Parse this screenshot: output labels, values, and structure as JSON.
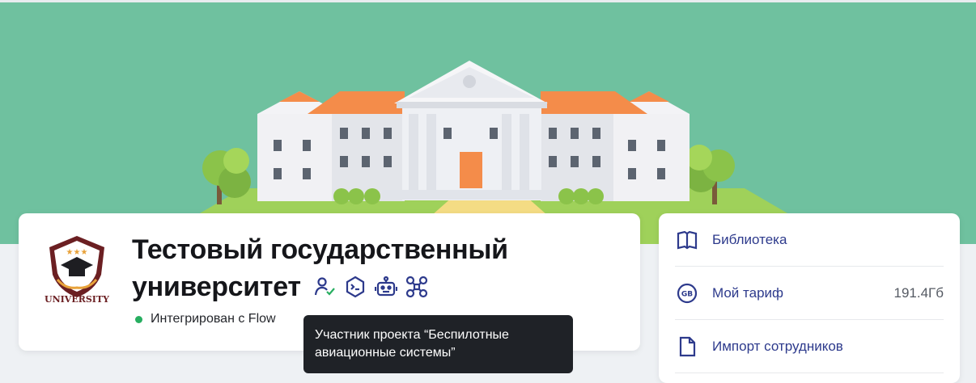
{
  "organization": {
    "title_line1": "Тестовый государственный",
    "title_line2": "университет",
    "logo_text": "UNIVERSITY",
    "status_text": "Интегрирован с Flow",
    "status_color": "#27ae60",
    "badges": [
      {
        "icon": "user-check-icon"
      },
      {
        "icon": "terminal-hexagon-icon"
      },
      {
        "icon": "robot-icon"
      },
      {
        "icon": "drone-icon"
      }
    ]
  },
  "tooltip": {
    "text": "Участник проекта “Беспилотные авиационные системы”"
  },
  "sidebar": {
    "items": [
      {
        "label": "Библиотека",
        "icon": "book-icon"
      },
      {
        "label": "Мой тариф",
        "icon": "gb-icon",
        "value": "191.4Гб"
      },
      {
        "label": "Импорт сотрудников",
        "icon": "document-icon"
      }
    ]
  },
  "colors": {
    "banner": "#6fc19f",
    "accent": "#2d3a8c",
    "tooltip_bg": "#1f2227"
  }
}
